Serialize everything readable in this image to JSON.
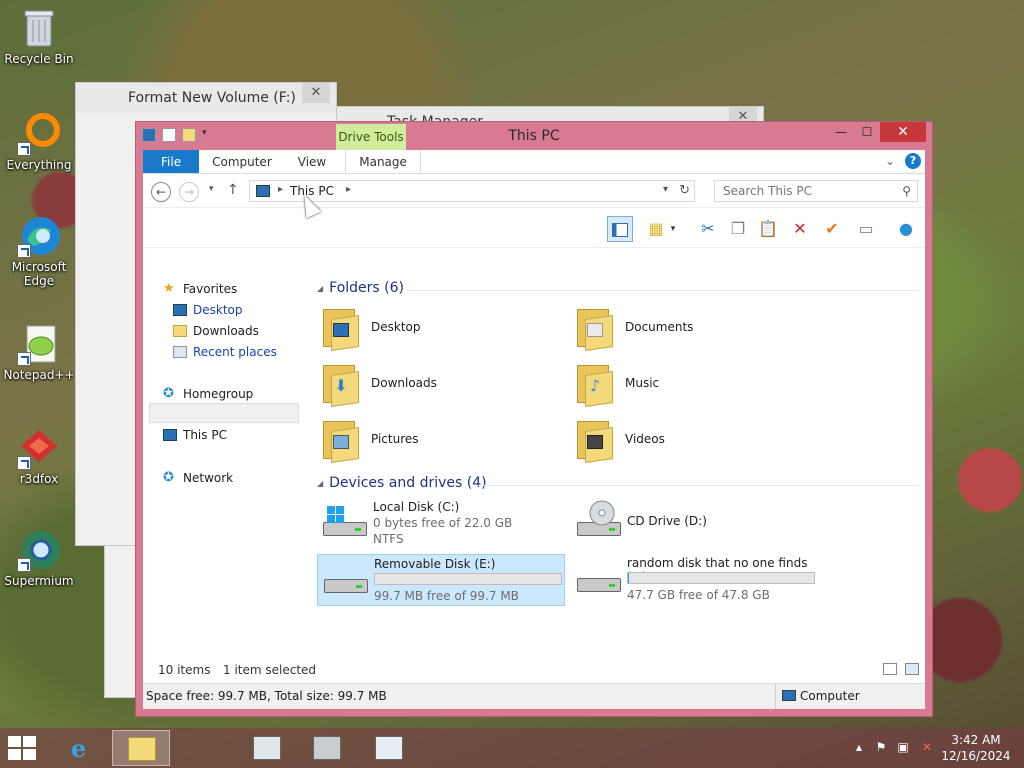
{
  "desktop": {
    "icons": [
      {
        "label": "Recycle Bin"
      },
      {
        "label": "Everything"
      },
      {
        "label": "Microsoft Edge"
      },
      {
        "label": "Notepad++"
      },
      {
        "label": "r3dfox"
      },
      {
        "label": "Supermium"
      }
    ]
  },
  "background_windows": {
    "format_title": "Format New Volume (F:)",
    "task_manager_title": "Task Manager",
    "close_glyph": "✕"
  },
  "explorer": {
    "title": "This PC",
    "contextual_tab": "Drive Tools",
    "window_buttons": {
      "minimize": "—",
      "maximize": "☐",
      "close": "✕"
    },
    "ribbon_tabs": [
      {
        "label": "File"
      },
      {
        "label": "Computer"
      },
      {
        "label": "View"
      },
      {
        "label": "Manage"
      }
    ],
    "help_label": "?",
    "address": {
      "crumb": "This PC",
      "search_placeholder": "Search This PC"
    },
    "nav_pane": {
      "favorites": "Favorites",
      "desktop": "Desktop",
      "downloads": "Downloads",
      "recent": "Recent places",
      "homegroup": "Homegroup",
      "this_pc": "This PC",
      "network": "Network"
    },
    "folders_header": "Folders (6)",
    "folders": [
      {
        "name": "Desktop",
        "badge_color": "#2b6fb6"
      },
      {
        "name": "Documents",
        "badge_color": "#eaeaea"
      },
      {
        "name": "Downloads",
        "badge_color": "#2d7fd1"
      },
      {
        "name": "Music",
        "badge_color": "#3f8fd6"
      },
      {
        "name": "Pictures",
        "badge_color": "#7bb0dd"
      },
      {
        "name": "Videos",
        "badge_color": "#444444"
      }
    ],
    "drives_header": "Devices and drives (4)",
    "drives": [
      {
        "name": "Local Disk (C:)",
        "line1": "0 bytes free of 22.0 GB",
        "line2": "NTFS"
      },
      {
        "name": "CD Drive (D:)"
      },
      {
        "name": "Removable Disk (E:)",
        "free": "99.7 MB free of 99.7 MB",
        "used_fraction": 0,
        "selected": true
      },
      {
        "name": "random disk that no one finds (F:)",
        "free": "47.7 GB free of 47.8 GB",
        "used_fraction": 0.002
      }
    ],
    "status": {
      "items": "10 items",
      "selected": "1 item selected",
      "space": "Space free: 99.7 MB, Total size: 99.7 MB",
      "location": "Computer"
    },
    "colors": {
      "accent": "#1979ca",
      "frame": "#d97a93",
      "context_tab": "#d2ec9e"
    }
  },
  "taskbar": {
    "time": "3:42 AM",
    "date": "12/16/2024"
  }
}
